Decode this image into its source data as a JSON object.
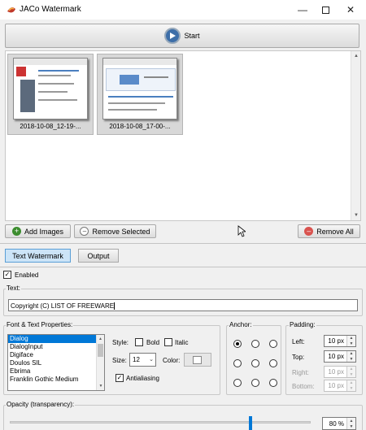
{
  "window": {
    "title": "JACo Watermark"
  },
  "toolbar": {
    "start_label": "Start"
  },
  "images": [
    {
      "label": "2018-10-08_12-19-..."
    },
    {
      "label": "2018-10-08_17-00-..."
    }
  ],
  "image_buttons": {
    "add": "Add Images",
    "remove_selected": "Remove Selected",
    "remove_all": "Remove All"
  },
  "tabs": [
    {
      "label": "Text Watermark"
    },
    {
      "label": "Output"
    }
  ],
  "enabled": {
    "label": "Enabled",
    "checked": true
  },
  "text_group": {
    "title": "Text:",
    "value": "Copyright (C) LIST OF FREEWARE"
  },
  "font_group": {
    "title": "Font & Text Properties:",
    "fonts": [
      "Dialog",
      "DialogInput",
      "Digiface",
      "Doulos SIL",
      "Ebrima",
      "Franklin Gothic Medium"
    ],
    "selected": "Dialog",
    "style_label": "Style:",
    "bold_label": "Bold",
    "italic_label": "Italic",
    "size_label": "Size:",
    "size_value": "12",
    "color_label": "Color:",
    "antialiasing_label": "Antialiasing",
    "antialiasing_checked": true
  },
  "anchor_group": {
    "title": "Anchor:",
    "selected": "top-left"
  },
  "padding_group": {
    "title": "Padding:",
    "left_label": "Left:",
    "left_value": "10 px",
    "top_label": "Top:",
    "top_value": "10 px",
    "right_label": "Right:",
    "right_value": "10 px",
    "bottom_label": "Bottom:",
    "bottom_value": "10 px"
  },
  "opacity_group": {
    "title": "Opacity (transparency):",
    "value": "80 %",
    "level_percent": 80
  },
  "colors": {
    "accent": "#0078d7",
    "tab_active": "#cce4f7",
    "remove_icon": "#d9534f",
    "add_icon": "#3c8d2f"
  }
}
